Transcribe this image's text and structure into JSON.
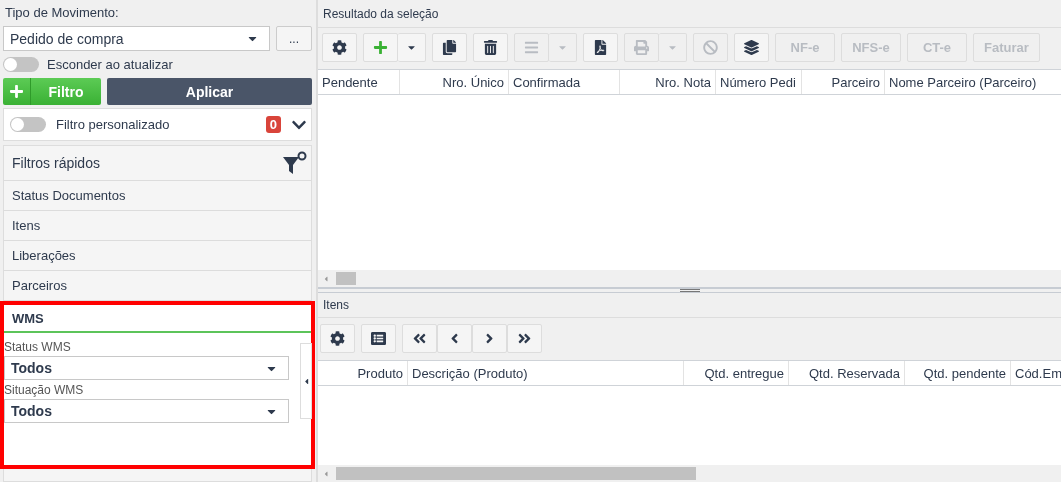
{
  "movement_type": {
    "label": "Tipo de Movimento:",
    "value": "Pedido de compra",
    "more_button": "..."
  },
  "hide_on_update": {
    "label": "Esconder ao atualizar",
    "on": false
  },
  "filter_button": "Filtro",
  "apply_button": "Aplicar",
  "custom_filter": {
    "label": "Filtro personalizado",
    "on": false,
    "count": "0"
  },
  "quick_filters": {
    "title": "Filtros rápidos",
    "sections": [
      {
        "label": "Status Documentos",
        "expanded": false,
        "highlighted": false
      },
      {
        "label": "Itens",
        "expanded": false,
        "highlighted": false
      },
      {
        "label": "Liberações",
        "expanded": false,
        "highlighted": false
      },
      {
        "label": "Parceiros",
        "expanded": false,
        "highlighted": false
      },
      {
        "label": "WMS",
        "expanded": true,
        "highlighted": true,
        "fields": [
          {
            "label": "Status WMS",
            "value": "Todos"
          },
          {
            "label": "Situação WMS",
            "value": "Todos"
          }
        ]
      }
    ]
  },
  "results": {
    "title": "Resultado da seleção",
    "toolbar": [
      {
        "kind": "settings",
        "disabled": false
      },
      {
        "kind": "add",
        "disabled": false,
        "menu": true
      },
      {
        "kind": "copy",
        "disabled": false
      },
      {
        "kind": "delete",
        "disabled": false
      },
      {
        "kind": "report",
        "disabled": true,
        "menu": true
      },
      {
        "kind": "pdf",
        "disabled": false
      },
      {
        "kind": "print",
        "disabled": true,
        "menu": true
      },
      {
        "kind": "cancel",
        "disabled": true
      },
      {
        "kind": "stack",
        "disabled": false
      },
      {
        "kind": "text",
        "label": "NF-e",
        "disabled": true
      },
      {
        "kind": "text",
        "label": "NFS-e",
        "disabled": true
      },
      {
        "kind": "text",
        "label": "CT-e",
        "disabled": true
      },
      {
        "kind": "text",
        "label": "Faturar",
        "disabled": true
      }
    ],
    "columns": [
      {
        "label": "Pendente"
      },
      {
        "label": "Nro. Único"
      },
      {
        "label": "Confirmada"
      },
      {
        "label": "Nro. Nota"
      },
      {
        "label": "Número Pedi"
      },
      {
        "label": "Parceiro"
      },
      {
        "label": "Nome Parceiro (Parceiro)"
      }
    ]
  },
  "items": {
    "title": "Itens",
    "toolbar": [
      {
        "kind": "settings",
        "disabled": false
      },
      {
        "kind": "list",
        "disabled": false
      },
      {
        "kind": "first",
        "disabled": false
      },
      {
        "kind": "prev",
        "disabled": false
      },
      {
        "kind": "next",
        "disabled": false
      },
      {
        "kind": "last",
        "disabled": false
      }
    ],
    "columns": [
      {
        "label": "Produto"
      },
      {
        "label": "Descrição (Produto)"
      },
      {
        "label": "Qtd. entregue"
      },
      {
        "label": "Qtd. Reservada"
      },
      {
        "label": "Qtd. pendente"
      },
      {
        "label": "Cód.Em"
      }
    ]
  }
}
